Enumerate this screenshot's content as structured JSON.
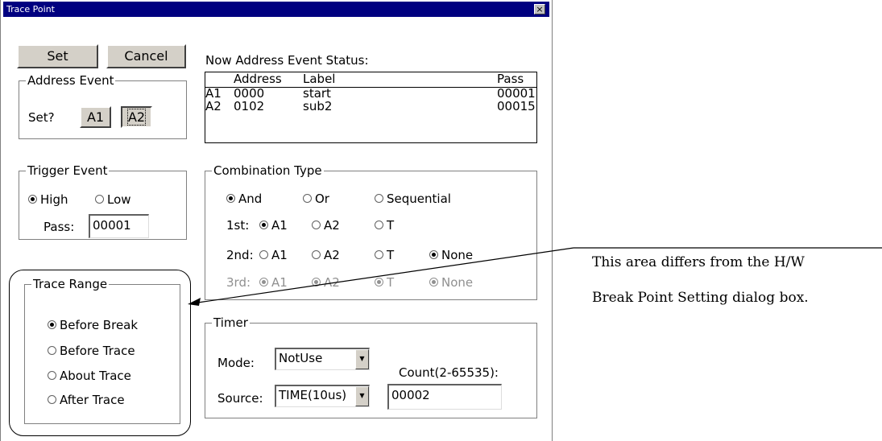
{
  "window": {
    "title": "Trace Point",
    "close_label": "×"
  },
  "buttons": {
    "set": "Set",
    "cancel": "Cancel"
  },
  "address_event": {
    "title": "Address Event",
    "set_label": "Set?",
    "a1": "A1",
    "a2": "A2"
  },
  "status": {
    "title": "Now Address Event Status:",
    "headers": {
      "address": "Address",
      "label": "Label",
      "pass": "Pass"
    },
    "rows": [
      {
        "name": "A1",
        "address": "0000",
        "label": "start",
        "pass": "00001"
      },
      {
        "name": "A2",
        "address": "0102",
        "label": "sub2",
        "pass": "00015"
      }
    ]
  },
  "trigger_event": {
    "title": "Trigger Event",
    "high": "High",
    "low": "Low",
    "pass_label": "Pass:",
    "pass_value": "00001"
  },
  "combination": {
    "title": "Combination Type",
    "and": "And",
    "or": "Or",
    "sequential": "Sequential",
    "first_label": "1st:",
    "second_label": "2nd:",
    "third_label": "3rd:",
    "a1": "A1",
    "a2": "A2",
    "t": "T",
    "none": "None"
  },
  "trace_range": {
    "title": "Trace Range",
    "before_break": "Before Break",
    "before_trace": "Before Trace",
    "about_trace": "About Trace",
    "after_trace": "After Trace"
  },
  "timer": {
    "title": "Timer",
    "mode_label": "Mode:",
    "mode_value": "NotUse",
    "source_label": "Source:",
    "source_value": "TIME(10us)",
    "count_label": "Count(2-65535):",
    "count_value": "00002"
  },
  "annotation": {
    "line1": "This area differs from the H/W",
    "line2": "Break Point Setting dialog box."
  }
}
